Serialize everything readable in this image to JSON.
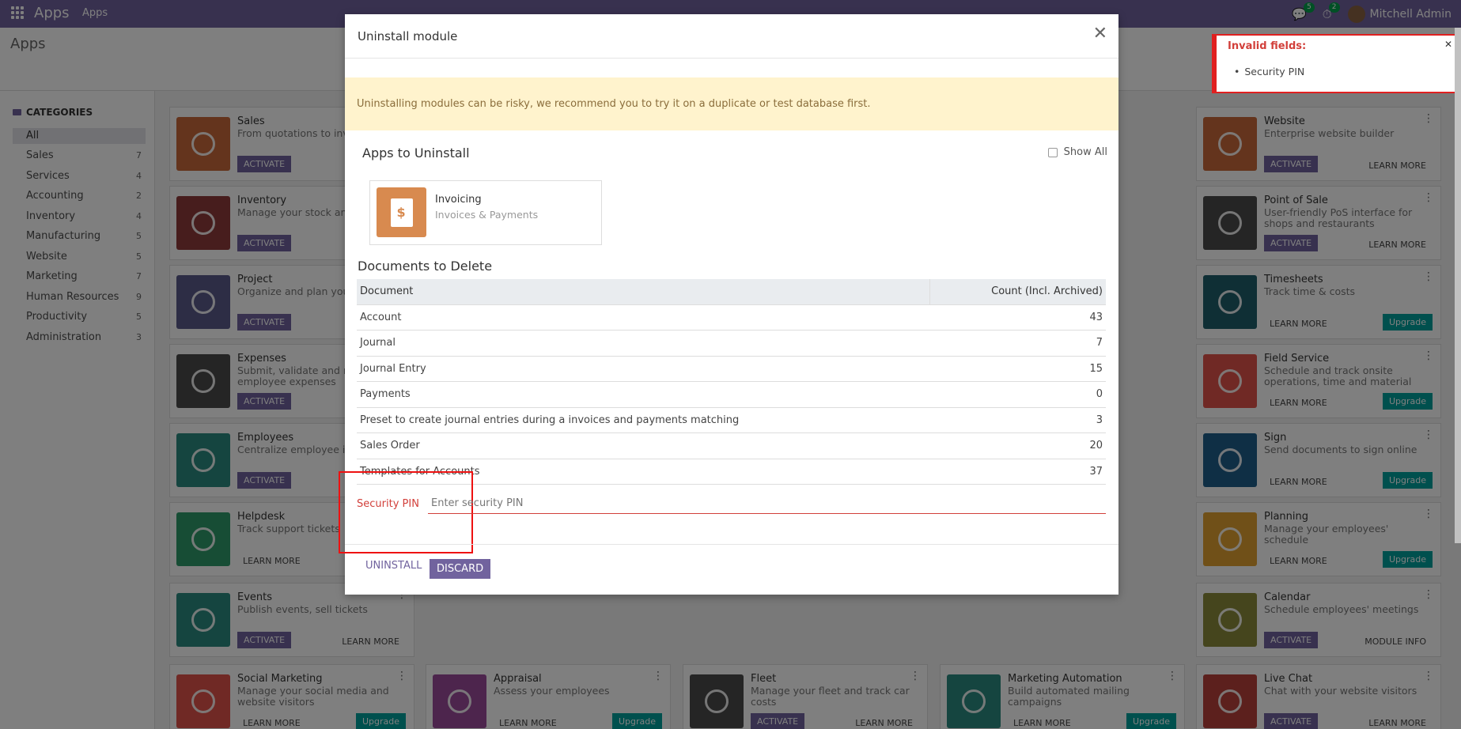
{
  "navbar": {
    "brand": "Apps",
    "menu": "Apps",
    "chat_count": "5",
    "activity_count": "2",
    "user": "Mitchell Admin"
  },
  "control_panel": {
    "title": "Apps"
  },
  "sidebar": {
    "header": "CATEGORIES",
    "items": [
      {
        "label": "All",
        "count": ""
      },
      {
        "label": "Sales",
        "count": "7"
      },
      {
        "label": "Services",
        "count": "4"
      },
      {
        "label": "Accounting",
        "count": "2"
      },
      {
        "label": "Inventory",
        "count": "4"
      },
      {
        "label": "Manufacturing",
        "count": "5"
      },
      {
        "label": "Website",
        "count": "5"
      },
      {
        "label": "Marketing",
        "count": "7"
      },
      {
        "label": "Human Resources",
        "count": "9"
      },
      {
        "label": "Productivity",
        "count": "5"
      },
      {
        "label": "Administration",
        "count": "3"
      }
    ]
  },
  "apps": [
    {
      "name": "Sales",
      "desc": "From quotations to invo",
      "btn": "ACTIVATE",
      "color": "#c9683b"
    },
    {
      "name": "Inventory",
      "desc": "Manage your stock and activities",
      "btn": "ACTIVATE",
      "color": "#8e3b3b"
    },
    {
      "name": "Project",
      "desc": "Organize and plan your",
      "btn": "ACTIVATE",
      "color": "#5a5a8a"
    },
    {
      "name": "Expenses",
      "desc": "Submit, validate and re employee expenses",
      "btn": "ACTIVATE",
      "color": "#4a4a4a"
    },
    {
      "name": "Employees",
      "desc": "Centralize employee inf",
      "btn": "ACTIVATE",
      "color": "#2a8a80"
    },
    {
      "name": "Helpdesk",
      "desc": "Track support tickets",
      "btn": "LEARN MORE",
      "color": "#2f9a6a"
    },
    {
      "name": "Events",
      "desc": "Publish events, sell tickets",
      "btn": "ACTIVATE",
      "more": "LEARN MORE",
      "color": "#2a8a80"
    },
    {
      "name": "Social Marketing",
      "desc": "Manage your social media and website visitors",
      "btn": "LEARN MORE",
      "up": "Upgrade",
      "color": "#e0534a"
    },
    {
      "name": "Website",
      "desc": "Enterprise website builder",
      "btn": "ACTIVATE",
      "more": "LEARN MORE",
      "color": "#c9683b"
    },
    {
      "name": "Point of Sale",
      "desc": "User-friendly PoS interface for shops and restaurants",
      "btn": "ACTIVATE",
      "more": "LEARN MORE",
      "color": "#4a4a4a"
    },
    {
      "name": "Timesheets",
      "desc": "Track time & costs",
      "btn": "LEARN MORE",
      "up": "Upgrade",
      "color": "#1f5f6a"
    },
    {
      "name": "Field Service",
      "desc": "Schedule and track onsite operations, time and material",
      "btn": "LEARN MORE",
      "up": "Upgrade",
      "color": "#e0534a"
    },
    {
      "name": "Sign",
      "desc": "Send documents to sign online",
      "btn": "LEARN MORE",
      "up": "Upgrade",
      "color": "#1f5f8a"
    },
    {
      "name": "Planning",
      "desc": "Manage your employees' schedule",
      "btn": "LEARN MORE",
      "up": "Upgrade",
      "color": "#e0a030"
    },
    {
      "name": "Calendar",
      "desc": "Schedule employees' meetings",
      "btn": "ACTIVATE",
      "more": "MODULE INFO",
      "color": "#8a8a3a"
    },
    {
      "name": "Live Chat",
      "desc": "Chat with your website visitors",
      "btn": "ACTIVATE",
      "more": "LEARN MORE",
      "color": "#b8403a"
    },
    {
      "name": "Appraisal",
      "desc": "Assess your employees",
      "btn": "LEARN MORE",
      "up": "Upgrade",
      "color": "#9a4a9a"
    },
    {
      "name": "Fleet",
      "desc": "Manage your fleet and track car costs",
      "btn": "ACTIVATE",
      "more": "LEARN MORE",
      "color": "#4a4a4a"
    },
    {
      "name": "Marketing Automation",
      "desc": "Build automated mailing campaigns",
      "btn": "LEARN MORE",
      "up": "Upgrade",
      "color": "#2a8a80"
    }
  ],
  "modal": {
    "title": "Uninstall module",
    "warning": "Uninstalling modules can be risky, we recommend you to try it on a duplicate or test database first.",
    "apps_title": "Apps to Uninstall",
    "show_all": "Show All",
    "app_name": "Invoicing",
    "app_sub": "Invoices & Payments",
    "docs_title": "Documents to Delete",
    "col_document": "Document",
    "col_count": "Count (Incl. Archived)",
    "rows": [
      {
        "doc": "Account",
        "count": "43"
      },
      {
        "doc": "Journal",
        "count": "7"
      },
      {
        "doc": "Journal Entry",
        "count": "15"
      },
      {
        "doc": "Payments",
        "count": "0"
      },
      {
        "doc": "Preset to create journal entries during a invoices and payments matching",
        "count": "3"
      },
      {
        "doc": "Sales Order",
        "count": "20"
      },
      {
        "doc": "Templates for Accounts",
        "count": "37"
      }
    ],
    "pin_label": "Security PIN",
    "pin_placeholder": "Enter security PIN",
    "uninstall": "UNINSTALL",
    "discard": "DISCARD"
  },
  "toast": {
    "title": "Invalid fields:",
    "item": "Security PIN"
  }
}
